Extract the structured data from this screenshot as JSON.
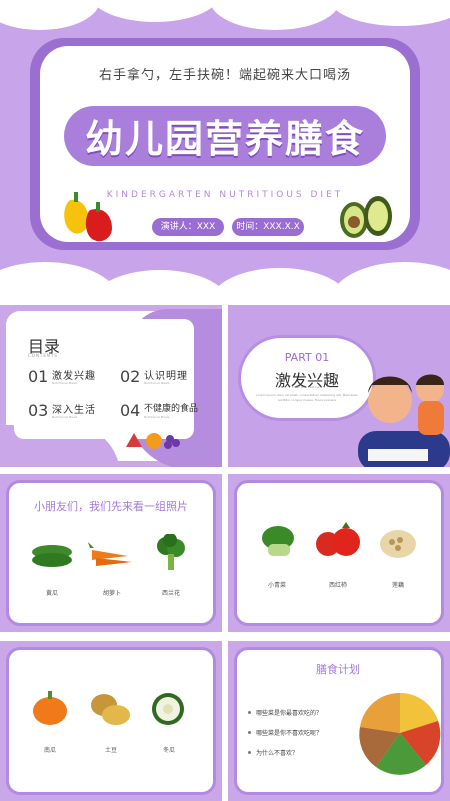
{
  "cover": {
    "motto": "右手拿勺，左手扶碗！端起碗来大口喝汤",
    "title": "幼儿园营养膳食",
    "subtitle": "KINDERGARTEN NUTRITIOUS DIET",
    "presenter": "演讲人：XXX",
    "time": "时间：XXX.X.X"
  },
  "contents": {
    "title": "目录",
    "subtitle": "CONTENTS",
    "items": [
      {
        "num": "01",
        "label": "激发兴趣",
        "sub": "Nutritional Meals"
      },
      {
        "num": "02",
        "label": "认识明理",
        "sub": "Nutritional Meals"
      },
      {
        "num": "03",
        "label": "深入生活",
        "sub": "Nutritional Meals"
      },
      {
        "num": "04",
        "label": "不健康的食品",
        "sub": "Nutritional Meals"
      }
    ]
  },
  "part": {
    "number": "PART 01",
    "title": "激发兴趣",
    "tagline": "Enter your text here",
    "body": "Lorem ipsum dolor sit amet, consectetuer adipiscing elit. Maecenas porttitor congue massa. Fusce posuere"
  },
  "food1": {
    "heading": "小朋友们，我们先来看一组照片",
    "items": [
      "黄瓜",
      "胡萝卜",
      "西兰花"
    ]
  },
  "food2": {
    "items": [
      "小青菜",
      "西红柿",
      "莲藕"
    ]
  },
  "food3": {
    "items": [
      "南瓜",
      "土豆",
      "冬瓜"
    ]
  },
  "plan": {
    "heading": "膳食计划",
    "questions": [
      "哪些菜是你最喜欢吃的？",
      "哪些菜是你不喜欢吃呢？",
      "为什么不喜欢？"
    ]
  },
  "colors": {
    "primary_purple": "#9b6fd0",
    "light_purple": "#c8a4ea",
    "white": "#ffffff"
  }
}
